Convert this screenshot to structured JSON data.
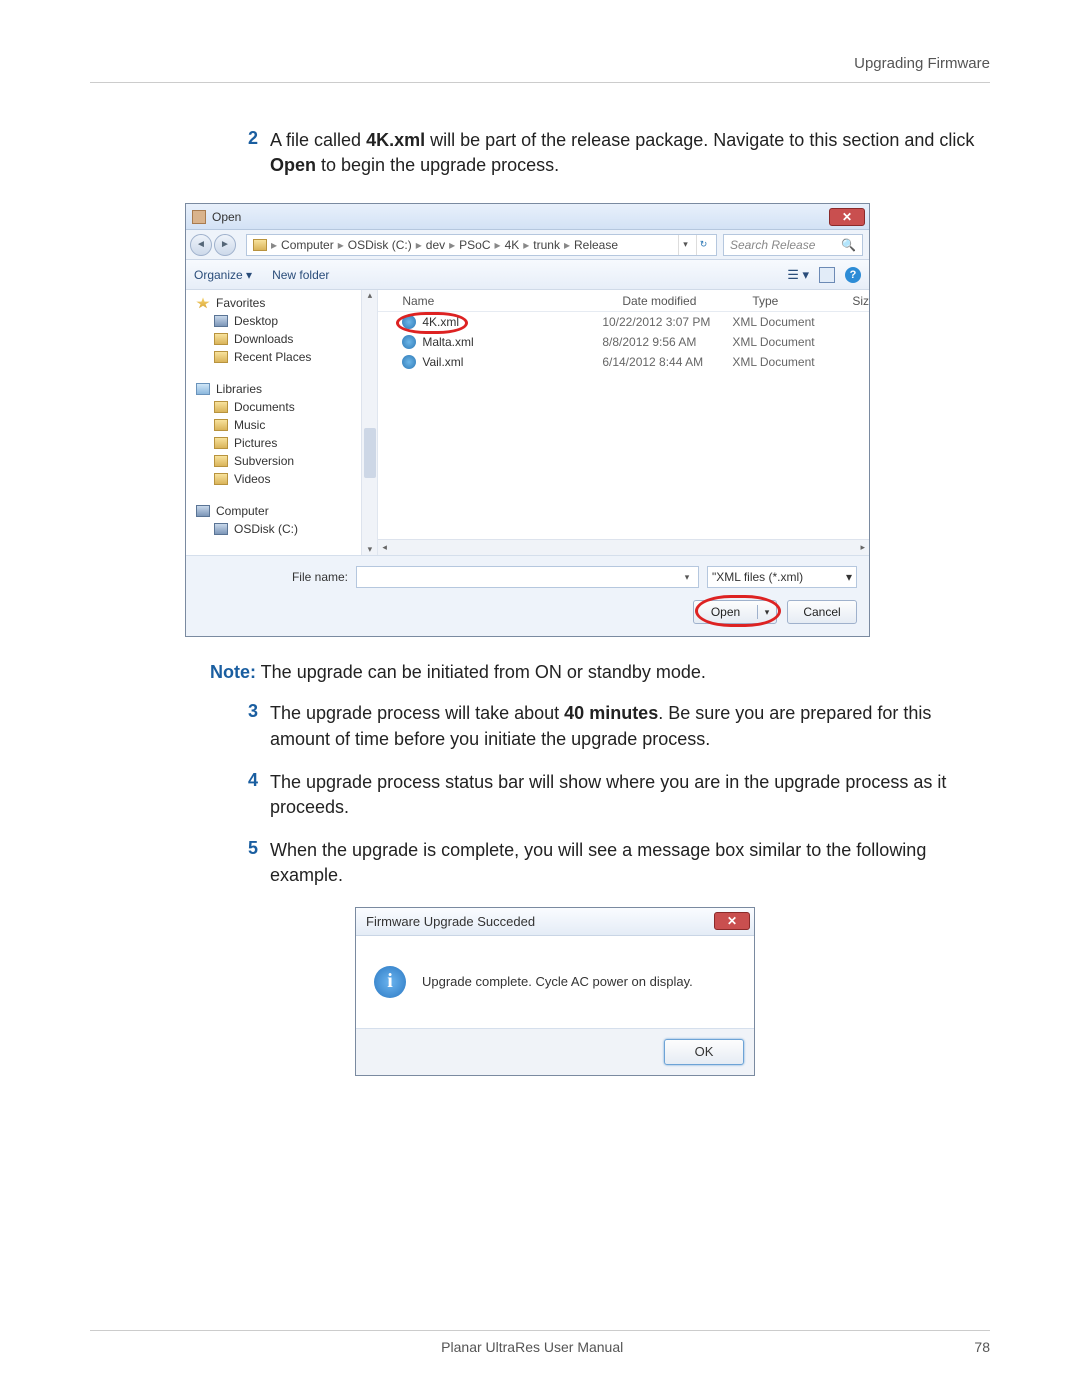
{
  "header": {
    "section": "Upgrading Firmware"
  },
  "steps": {
    "s2": {
      "num": "2",
      "pre": "A file called ",
      "bold1": "4K.xml",
      "mid": " will be part of the release package. Navigate to this section and click ",
      "bold2": "Open",
      "post": " to begin the upgrade process."
    },
    "s3": {
      "num": "3",
      "pre": "The upgrade process will take about ",
      "bold1": "40 minutes",
      "post": ". Be sure you are prepared for this amount of time before you initiate the upgrade process."
    },
    "s4": {
      "num": "4",
      "text": "The upgrade process status bar will show where you are in the upgrade process as it proceeds."
    },
    "s5": {
      "num": "5",
      "text": "When the upgrade is complete, you will see a message box similar to the following example."
    }
  },
  "note": {
    "label": "Note:",
    "text": " The upgrade can be initiated from ON or standby mode."
  },
  "dialog": {
    "title": "Open",
    "path": [
      "Computer",
      "OSDisk (C:)",
      "dev",
      "PSoC",
      "4K",
      "trunk",
      "Release"
    ],
    "search_placeholder": "Search Release",
    "toolbar": {
      "organize": "Organize ▾",
      "newfolder": "New folder"
    },
    "nav": {
      "favorites": "Favorites",
      "desktop": "Desktop",
      "downloads": "Downloads",
      "recent": "Recent Places",
      "libraries": "Libraries",
      "documents": "Documents",
      "music": "Music",
      "pictures": "Pictures",
      "subversion": "Subversion",
      "videos": "Videos",
      "computer": "Computer",
      "osdisk": "OSDisk (C:)"
    },
    "cols": {
      "name": "Name",
      "date": "Date modified",
      "type": "Type",
      "size": "Siz"
    },
    "files": [
      {
        "name": "4K.xml",
        "date": "10/22/2012 3:07 PM",
        "type": "XML Document"
      },
      {
        "name": "Malta.xml",
        "date": "8/8/2012 9:56 AM",
        "type": "XML Document"
      },
      {
        "name": "Vail.xml",
        "date": "6/14/2012 8:44 AM",
        "type": "XML Document"
      }
    ],
    "filename_label": "File name:",
    "filter": "\"XML files (*.xml)",
    "open": "Open",
    "cancel": "Cancel"
  },
  "msgbox": {
    "title": "Firmware Upgrade Succeded",
    "body": "Upgrade complete.  Cycle AC power on display.",
    "ok": "OK"
  },
  "footer": {
    "manual": "Planar UltraRes User Manual",
    "page": "78"
  }
}
